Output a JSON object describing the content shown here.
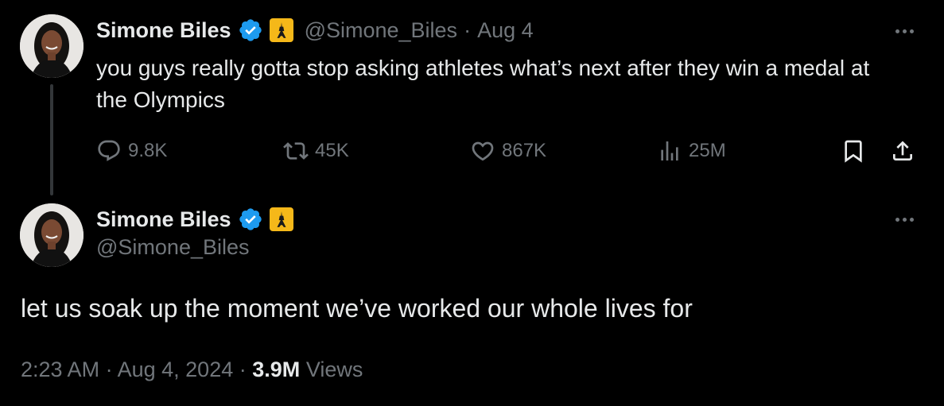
{
  "tweet1": {
    "display_name": "Simone Biles",
    "handle": "@Simone_Biles",
    "separator": "·",
    "date": "Aug 4",
    "text": "you guys really gotta stop asking athletes what’s next after they win a medal at the Olympics",
    "stats": {
      "replies": "9.8K",
      "reposts": "45K",
      "likes": "867K",
      "views": "25M"
    },
    "icons": [
      "reply-icon",
      "repost-icon",
      "like-icon",
      "views-icon",
      "bookmark-icon",
      "share-icon",
      "more-icon",
      "verified-icon",
      "eiffel-tower-icon"
    ]
  },
  "tweet2": {
    "display_name": "Simone Biles",
    "handle": "@Simone_Biles",
    "text": "let us soak up the moment we’ve worked our whole lives for",
    "time": "2:23 AM",
    "separator": "·",
    "full_date": "Aug 4, 2024",
    "views_count": "3.9M",
    "views_label": "Views"
  },
  "colors": {
    "background": "#000000",
    "primary_text": "#e7e9ea",
    "secondary_text": "#71767b",
    "verified_blue": "#1d9bf0",
    "emoji_gold": "#f5b819"
  }
}
